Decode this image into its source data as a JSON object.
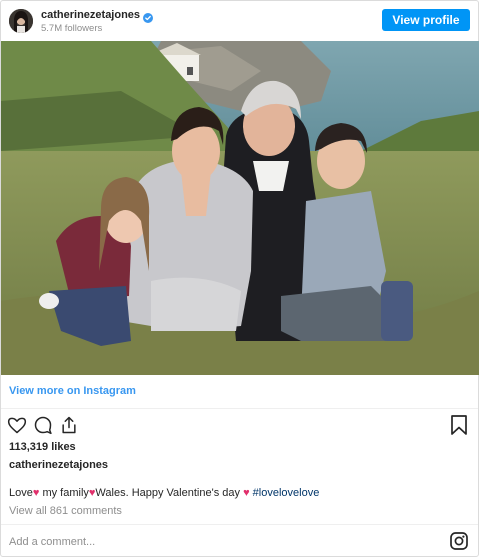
{
  "header": {
    "username": "catherinezetajones",
    "followers": "5.7M followers",
    "view_profile_label": "View profile",
    "verified_color": "#3897f0"
  },
  "post": {
    "image_alt": "Family photo on a grassy clifftop by the sea",
    "view_more_label": "View more on Instagram",
    "likes": "113,319 likes",
    "author": "catherinezetajones",
    "caption": {
      "part1": "Love",
      "part2": " my family",
      "part3": "Wales. Happy Valentine's day",
      "heart": "♥",
      "hashtag": "#lovelovelove"
    },
    "view_comments": "View all 861 comments",
    "comment_placeholder": "Add a comment..."
  },
  "icons": {
    "like": "heart-outline-icon",
    "comment": "speech-bubble-icon",
    "share": "share-icon",
    "save": "bookmark-icon",
    "instagram": "instagram-icon"
  },
  "colors": {
    "button": "#0095f6",
    "link": "#3897f0",
    "hashtag": "#003569",
    "heart": "#e1306c"
  }
}
